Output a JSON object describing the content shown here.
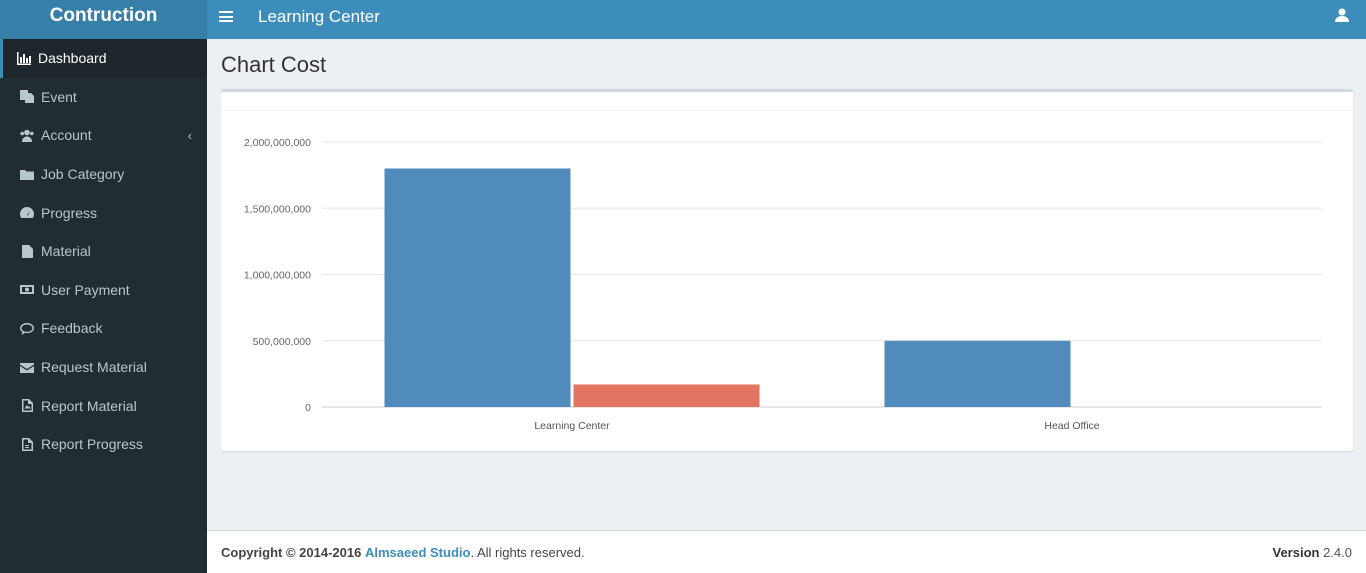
{
  "app": {
    "brand": "Contruction",
    "title": "Learning Center"
  },
  "sidebar": {
    "items": [
      {
        "label": "Dashboard",
        "icon": "bar-chart-icon",
        "active": true
      },
      {
        "label": "Event",
        "icon": "copy-icon"
      },
      {
        "label": "Account",
        "icon": "users-icon",
        "has_caret": true
      },
      {
        "label": "Job Category",
        "icon": "folder-icon"
      },
      {
        "label": "Progress",
        "icon": "dashboard-gauge-icon"
      },
      {
        "label": "Material",
        "icon": "file-icon"
      },
      {
        "label": "User Payment",
        "icon": "money-icon"
      },
      {
        "label": "Feedback",
        "icon": "comment-icon"
      },
      {
        "label": "Request Material",
        "icon": "envelope-icon"
      },
      {
        "label": "Report Material",
        "icon": "image-file-icon"
      },
      {
        "label": "Report Progress",
        "icon": "pdf-file-icon"
      }
    ]
  },
  "main": {
    "page_title": "Chart Cost"
  },
  "chart_data": {
    "type": "bar",
    "categories": [
      "Learning Center",
      "Head Office"
    ],
    "series": [
      {
        "values": [
          1800000000,
          500000000
        ],
        "color": "#508bbb"
      },
      {
        "values": [
          170000000,
          0
        ],
        "color": "#e27461"
      }
    ],
    "y_ticks": [
      "0",
      "500,000,000",
      "1,000,000,000",
      "1,500,000,000",
      "2,000,000,000"
    ],
    "ylim": [
      0,
      2000000000
    ],
    "grid": true
  },
  "footer": {
    "copyright_prefix": "Copyright © 2014-2016",
    "company": "Almsaeed Studio",
    "suffix": ". All rights reserved.",
    "version_label": "Version",
    "version_number": "2.4.0"
  },
  "colors": {
    "header": "#3c8dbc",
    "sidebar": "#222d32",
    "bar_blue": "#508bbb",
    "bar_red": "#e27461"
  }
}
